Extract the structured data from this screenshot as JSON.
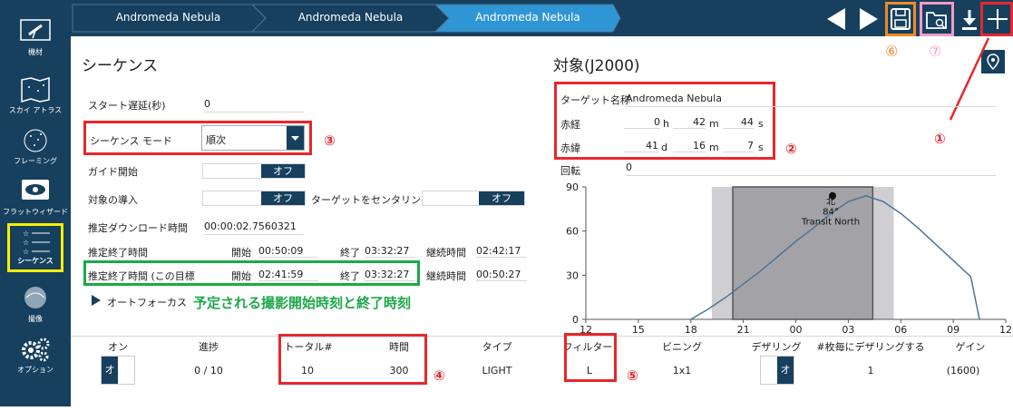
{
  "breadcrumb": [
    "Andromeda Nebula",
    "Andromeda Nebula",
    "Andromeda Nebula"
  ],
  "sidebar": {
    "items": [
      {
        "label": "機材",
        "icon": "telescope-icon"
      },
      {
        "label": "スカイ アトラス",
        "icon": "sky-atlas-icon"
      },
      {
        "label": "フレーミング",
        "icon": "framing-icon"
      },
      {
        "label": "フラットウィザード",
        "icon": "flat-wizard-icon"
      },
      {
        "label": "シーケンス",
        "icon": "sequence-icon"
      },
      {
        "label": "撮像",
        "icon": "imaging-icon"
      },
      {
        "label": "オプション",
        "icon": "gears-icon"
      }
    ]
  },
  "sequence": {
    "title": "シーケンス",
    "start_delay_label": "スタート遅延(秒)",
    "start_delay_value": "0",
    "mode_label": "シーケンス モード",
    "mode_value": "順次",
    "guide_label": "ガイド開始",
    "guide_toggle": "オフ",
    "slew_label": "対象の導入",
    "slew_toggle": "オフ",
    "center_label": "ターゲットをセンタリング",
    "center_toggle": "オフ",
    "download_label": "推定ダウンロード時間",
    "download_value": "00:00:02.7560321",
    "est_end_label": "推定終了時間",
    "est_end_start_label": "開始",
    "est_end_start": "00:50:09",
    "est_end_end_label": "終了",
    "est_end_end": "03:32:27",
    "est_end_dur_label": "継続時間",
    "est_end_dur": "02:42:17",
    "est_end_target_label": "推定終了時間 (この目標",
    "est_end_target_start_label": "開始",
    "est_end_target_start": "02:41:59",
    "est_end_target_end_label": "終了",
    "est_end_target_end": "03:32:27",
    "est_end_target_dur_label": "継続時間",
    "est_end_target_dur": "00:50:27",
    "autofocus_label": "オートフォーカス",
    "annotation_green": "予定される撮影開始時刻と終了時刻"
  },
  "target": {
    "title": "対象(J2000)",
    "name_label": "ターゲット名称",
    "name_value": "Andromeda Nebula",
    "ra_label": "赤経",
    "ra_h": "0",
    "ra_h_unit": "h",
    "ra_m": "42",
    "ra_m_unit": "m",
    "ra_s": "44",
    "ra_s_unit": "s",
    "dec_label": "赤緯",
    "dec_d": "41",
    "dec_d_unit": "d",
    "dec_m": "16",
    "dec_m_unit": "m",
    "dec_s": "7",
    "dec_s_unit": "s",
    "rotation_label": "回転",
    "rotation_value": "0"
  },
  "chart_data": {
    "type": "line",
    "x_ticks": [
      "12",
      "15",
      "18",
      "21",
      "00",
      "03",
      "06",
      "09",
      "12"
    ],
    "y_ticks": [
      "90",
      "60",
      "30",
      "0"
    ],
    "ylim": [
      0,
      90
    ],
    "xlabel": "",
    "ylabel": "",
    "series": [
      {
        "x": [
          18,
          19,
          20,
          21,
          22,
          23,
          24,
          25,
          26,
          27,
          28,
          29,
          30,
          31,
          32,
          33,
          34,
          34.5
        ],
        "y": [
          0,
          7,
          15,
          24,
          33,
          43,
          53,
          62,
          72,
          80,
          84,
          80,
          72,
          62,
          51,
          40,
          29,
          0
        ]
      }
    ],
    "transit_label_lines": [
      "北",
      "84°",
      "Transit North"
    ],
    "twilight_range": [
      19.2,
      29.6
    ],
    "night_range": [
      20.4,
      28.4
    ],
    "transit_x": 26.1,
    "transit_y": 84
  },
  "table": {
    "headers": [
      "オン",
      "進捗",
      "トータル#",
      "時間",
      "タイプ",
      "フィルター",
      "ビニング",
      "デザリング",
      "#枚毎にデザリングする",
      "ゲイン"
    ],
    "row": {
      "on_toggle": "オン",
      "progress": "0 / 10",
      "total": "10",
      "time": "300",
      "type": "LIGHT",
      "filter": "L",
      "binning": "1x1",
      "dither_toggle": "オフ",
      "dither_every": "1",
      "gain": "(1600)"
    }
  },
  "annotations": [
    "①",
    "②",
    "③",
    "④",
    "⑤",
    "⑥",
    "⑦"
  ],
  "colors": {
    "navy": "#16405e",
    "accent_blue": "#2f96d6",
    "red": "#e8262b",
    "green": "#1ea84a",
    "orange": "#f08a24",
    "pink": "#f29bc5",
    "yellow": "#ffef00"
  }
}
